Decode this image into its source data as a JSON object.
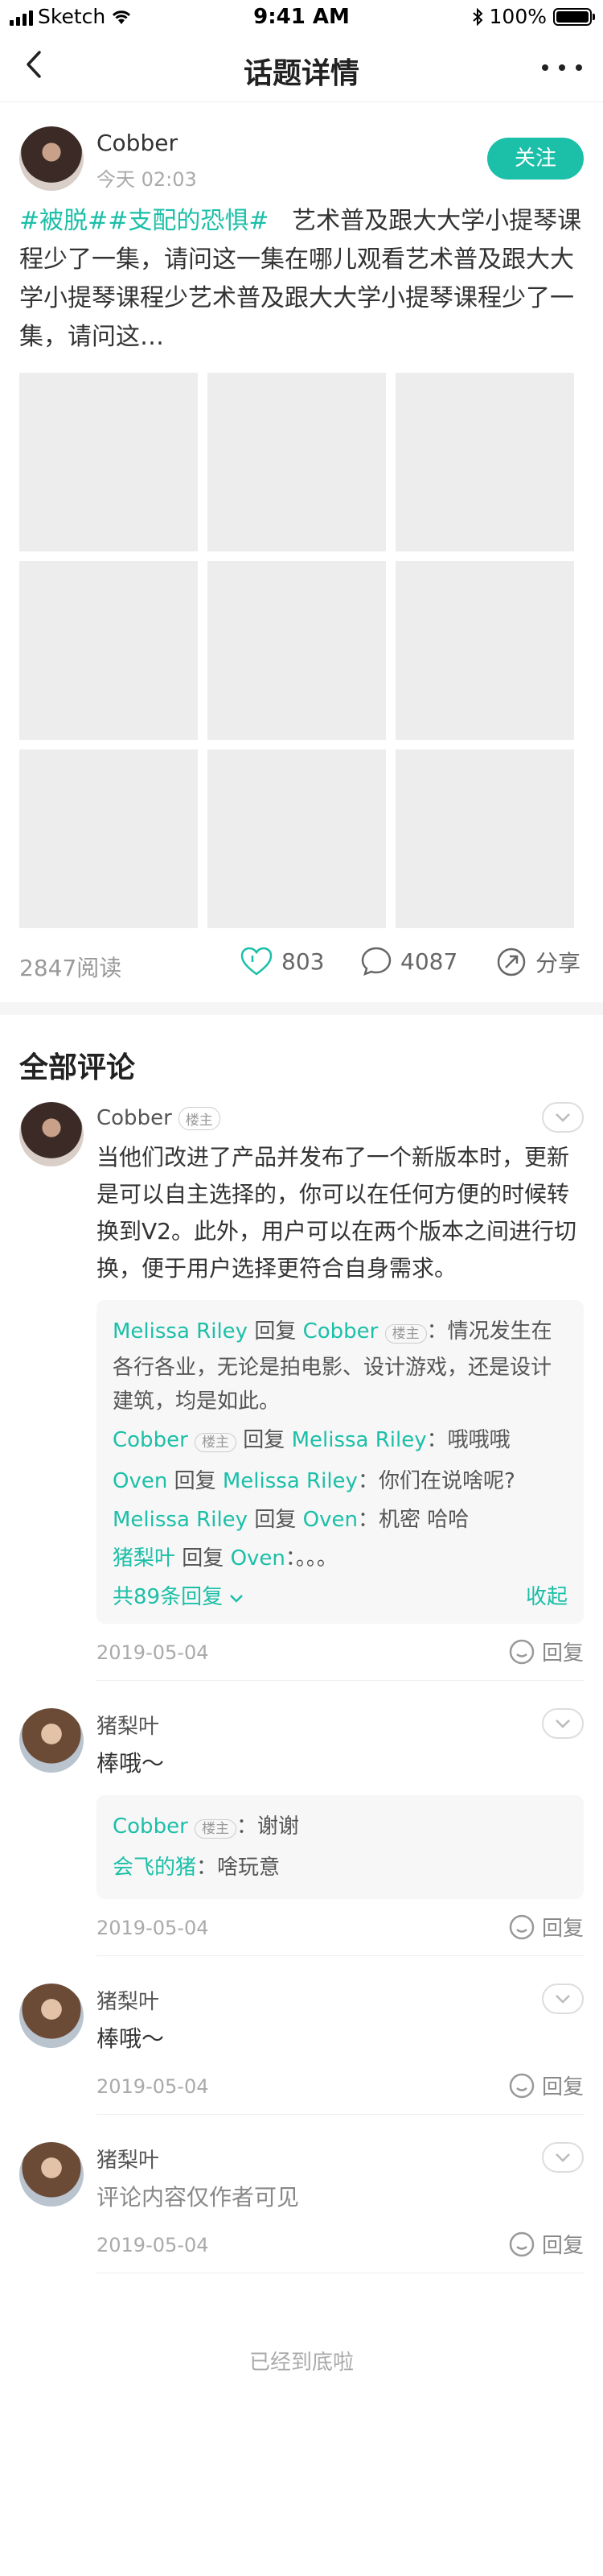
{
  "status_bar": {
    "carrier": "Sketch",
    "time": "9:41 AM",
    "battery": "100%"
  },
  "nav": {
    "title": "话题详情"
  },
  "post": {
    "author": "Cobber",
    "time": "今天 02:03",
    "follow_label": "关注",
    "tags": [
      "#被脱#",
      "#支配的恐惧#"
    ],
    "text": "艺术普及跟大大学小提琴课程少了一集，请问这一集在哪儿观看艺术普及跟大大学小提琴课程少艺术普及跟大大学小提琴课程少了一集，请问这…",
    "image_count": 9,
    "reads": "2847阅读",
    "likes": "803",
    "comments": "4087",
    "share": "分享"
  },
  "comments_title": "全部评论",
  "comments": [
    {
      "name": "Cobber",
      "badge": "楼主",
      "text": "当他们改进了产品并发布了一个新版本时，更新是可以自主选择的，你可以在任何方便的时候转换到V2。此外，用户可以在两个版本之间进行切换，便于用户选择更符合自身需求。",
      "replies": [
        {
          "from": "Melissa Riley",
          "verb": "回复",
          "to": "Cobber",
          "to_badge": "楼主",
          "text": "情况发生在各行各业，无论是拍电影、设计游戏，还是设计建筑，均是如此。"
        },
        {
          "from": "Cobber",
          "from_badge": "楼主",
          "verb": "回复",
          "to": "Melissa Riley",
          "text": "哦哦哦"
        },
        {
          "from": "Oven",
          "verb": "回复",
          "to": "Melissa Riley",
          "text": "你们在说啥呢?"
        },
        {
          "from": "Melissa Riley",
          "verb": "回复",
          "to": "Oven",
          "text": "机密 哈哈"
        },
        {
          "from": "猪梨叶",
          "verb": "回复",
          "to": "Oven",
          "text": "。。。"
        }
      ],
      "more_label": "共89条回复",
      "collapse_label": "收起",
      "date": "2019-05-04",
      "reply_label": "回复"
    },
    {
      "name": "猪梨叶",
      "text": "棒哦～",
      "replies": [
        {
          "from": "Cobber",
          "from_badge": "楼主",
          "text": "谢谢"
        },
        {
          "from": "会飞的猪",
          "text": "啥玩意"
        }
      ],
      "date": "2019-05-04",
      "reply_label": "回复"
    },
    {
      "name": "猪梨叶",
      "text": "棒哦～",
      "date": "2019-05-04",
      "reply_label": "回复"
    },
    {
      "name": "猪梨叶",
      "text": "评论内容仅作者可见",
      "date": "2019-05-04",
      "reply_label": "回复"
    }
  ],
  "end_text": "已经到底啦",
  "colors": {
    "accent": "#1cbfa8",
    "tag": "#1cbfa8"
  }
}
